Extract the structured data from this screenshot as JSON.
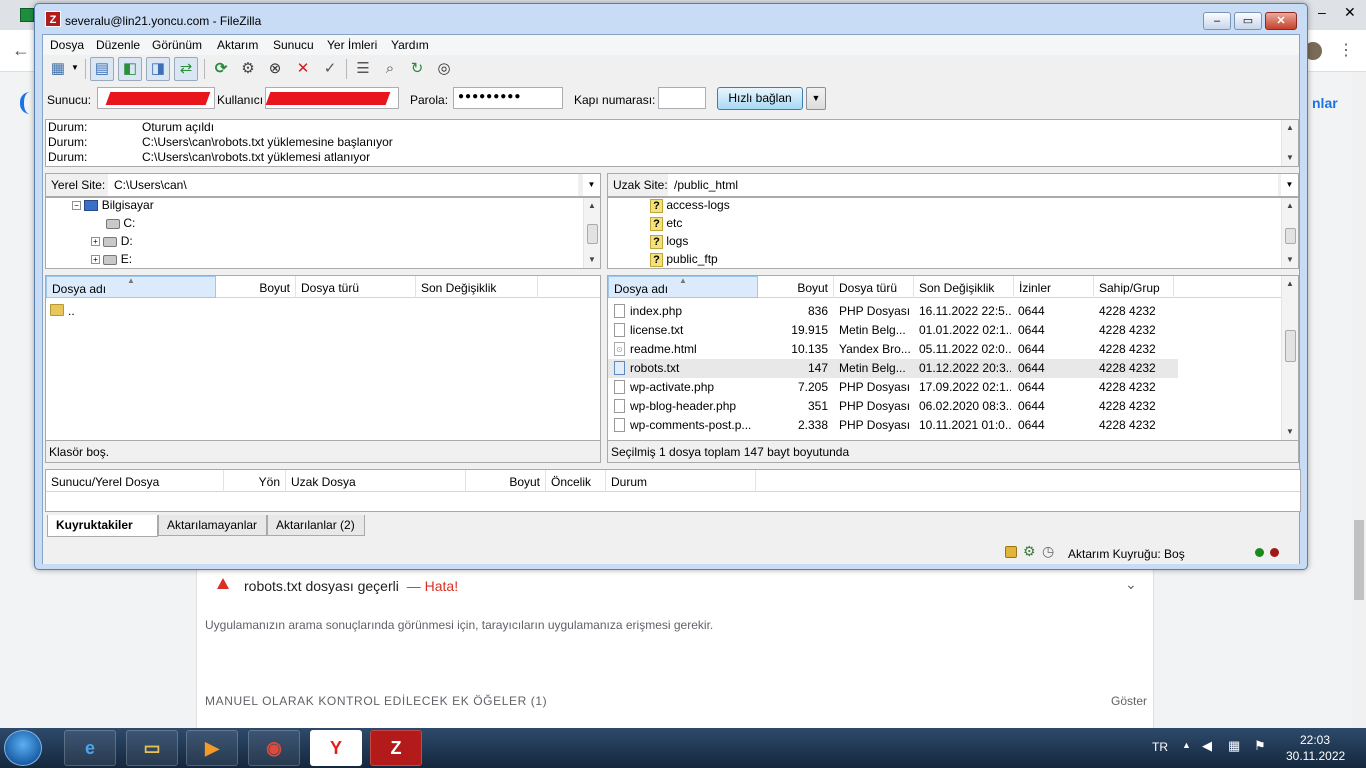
{
  "browser": {
    "content_link": "nlar"
  },
  "window": {
    "title": "severalu@lin21.yoncu.com - FileZilla",
    "app_icon": "filezilla-icon",
    "controls": {
      "minimize": "‒",
      "maximize": "▭",
      "close": "✕"
    }
  },
  "menu": [
    "Dosya",
    "Düzenle",
    "Görünüm",
    "Aktarım",
    "Sunucu",
    "Yer İmleri",
    "Yardım"
  ],
  "quickconnect": {
    "host_label": "Sunucu:",
    "user_label": "Kullanıcı",
    "pass_label": "Parola:",
    "pass_value": "●●●●●●●●●",
    "port_label": "Kapı numarası:",
    "port_value": "",
    "connect_button": "Hızlı bağlan",
    "dropdown": "▼"
  },
  "log": [
    {
      "label": "Durum:",
      "text": "Oturum açıldı"
    },
    {
      "label": "Durum:",
      "text": "C:\\Users\\can\\robots.txt yüklemesine başlanıyor"
    },
    {
      "label": "Durum:",
      "text": "C:\\Users\\can\\robots.txt yüklemesi atlanıyor"
    }
  ],
  "local": {
    "site_label": "Yerel Site:",
    "path": "C:\\Users\\can\\",
    "tree": [
      {
        "label": "Bilgisayar",
        "icon": "computer-icon"
      },
      {
        "label": "C:",
        "icon": "drive-icon"
      },
      {
        "label": "D:",
        "icon": "drive-icon"
      },
      {
        "label": "E:",
        "icon": "drive-icon"
      }
    ],
    "columns": [
      "Dosya adı",
      "Boyut",
      "Dosya türü",
      "Son Değişiklik"
    ],
    "files": [
      {
        "name": ".."
      }
    ],
    "status": "Klasör boş."
  },
  "remote": {
    "site_label": "Uzak Site:",
    "path": "/public_html",
    "tree": [
      "access-logs",
      "etc",
      "logs",
      "public_ftp"
    ],
    "columns": [
      "Dosya adı",
      "Boyut",
      "Dosya türü",
      "Son Değişiklik",
      "İzinler",
      "Sahip/Grup"
    ],
    "files": [
      {
        "name": "index.php",
        "size": "836",
        "type": "PHP Dosyası",
        "modified": "16.11.2022 22:5...",
        "perms": "0644",
        "owner": "4228 4232"
      },
      {
        "name": "license.txt",
        "size": "19.915",
        "type": "Metin Belg...",
        "modified": "01.01.2022 02:1...",
        "perms": "0644",
        "owner": "4228 4232"
      },
      {
        "name": "readme.html",
        "size": "10.135",
        "type": "Yandex Bro...",
        "modified": "05.11.2022 02:0...",
        "perms": "0644",
        "owner": "4228 4232"
      },
      {
        "name": "robots.txt",
        "size": "147",
        "type": "Metin Belg...",
        "modified": "01.12.2022 20:3...",
        "perms": "0644",
        "owner": "4228 4232"
      },
      {
        "name": "wp-activate.php",
        "size": "7.205",
        "type": "PHP Dosyası",
        "modified": "17.09.2022 02:1...",
        "perms": "0644",
        "owner": "4228 4232"
      },
      {
        "name": "wp-blog-header.php",
        "size": "351",
        "type": "PHP Dosyası",
        "modified": "06.02.2020 08:3...",
        "perms": "0644",
        "owner": "4228 4232"
      },
      {
        "name": "wp-comments-post.p...",
        "size": "2.338",
        "type": "PHP Dosyası",
        "modified": "10.11.2021 01:0...",
        "perms": "0644",
        "owner": "4228 4232"
      }
    ],
    "status": "Seçilmiş 1 dosya toplam 147 bayt boyutunda"
  },
  "queue": {
    "columns": [
      "Sunucu/Yerel Dosya",
      "Yön",
      "Uzak Dosya",
      "Boyut",
      "Öncelik",
      "Durum"
    ],
    "tabs": [
      "Kuyruktakiler",
      "Aktarılamayanlar",
      "Aktarılanlar (2)"
    ],
    "status": "Aktarım Kuyruğu: Boş",
    "indicator_colors": [
      "#1a8a1a",
      "#a01818"
    ]
  },
  "page": {
    "issue_title": "robots.txt dosyası geçerli",
    "issue_error": "— Hata!",
    "issue_desc": "Uygulamanızın arama sonuçlarında görünmesi için, tarayıcıların uygulamanıza erişmesi gerekir.",
    "manual_section": "MANUEL OLARAK KONTROL EDİLECEK EK ÖĞELER (1)",
    "show_link": "Göster",
    "error_color": "#d93025"
  },
  "taskbar": {
    "lang": "TR",
    "time": "22:03",
    "date": "30.11.2022"
  }
}
